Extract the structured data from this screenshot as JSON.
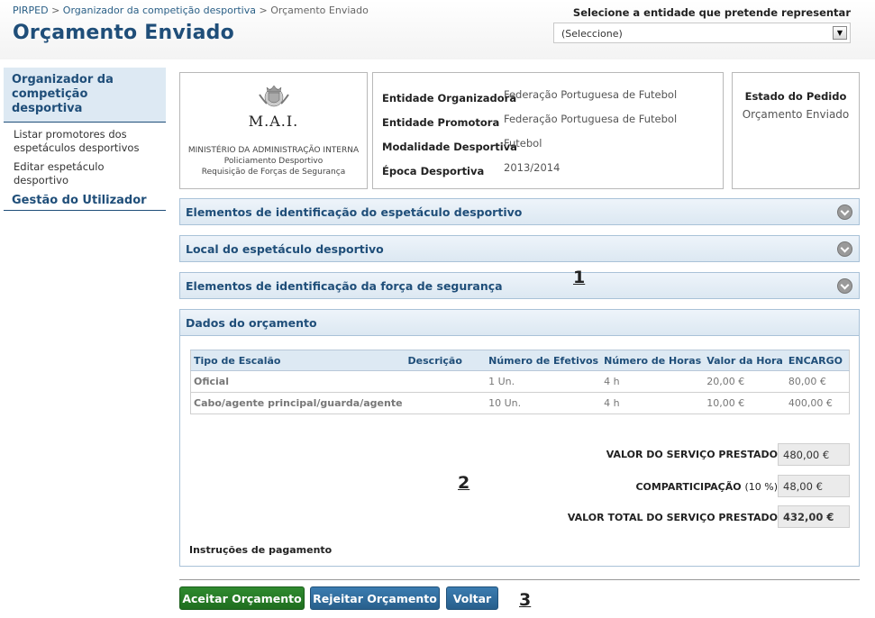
{
  "breadcrumb": [
    "PIRPED",
    "Organizador da competição desportiva",
    "Orçamento Enviado"
  ],
  "breadcrumb_sep": ">",
  "page_title": "Orçamento Enviado",
  "entity_selector": {
    "label": "Selecione a entidade que pretende representar",
    "value": "(Seleccione)"
  },
  "sidebar": {
    "active": "Organizador da competição desportiva",
    "items": [
      "Listar promotores dos espetáculos desportivos",
      "Editar espetáculo desportivo"
    ],
    "section": "Gestão do Utilizador"
  },
  "logo": {
    "acronym": "M.A.I.",
    "line1": "MINISTÉRIO DA ADMINISTRAÇÃO INTERNA",
    "line2": "Policiamento Desportivo",
    "line3": "Requisição de Forças de Segurança"
  },
  "info": [
    {
      "label": "Entidade Organizadora",
      "value": "Federação Portuguesa de Futebol"
    },
    {
      "label": "Entidade Promotora",
      "value": "Federação Portuguesa de Futebol"
    },
    {
      "label": "Modalidade Desportiva",
      "value": "Futebol"
    },
    {
      "label": "Época Desportiva",
      "value": "2013/2014"
    }
  ],
  "status": {
    "label": "Estado do Pedido",
    "value": "Orçamento Enviado"
  },
  "accordions": [
    "Elementos de identificação do espetáculo desportivo",
    "Local do espetáculo desportivo",
    "Elementos de identificação da força de segurança"
  ],
  "budget": {
    "title": "Dados do orçamento",
    "columns": [
      "Tipo de Escalão",
      "Descrição",
      "Número de Efetivos",
      "Número de Horas",
      "Valor da Hora",
      "ENCARGO"
    ],
    "rows": [
      [
        "Oficial",
        "",
        "1 Un.",
        "4 h",
        "20,00 €",
        "80,00 €"
      ],
      [
        "Cabo/agente principal/guarda/agente",
        "",
        "10 Un.",
        "4 h",
        "10,00 €",
        "400,00 €"
      ]
    ],
    "service_label": "VALOR DO SERVIÇO PRESTADO",
    "service_value": "480,00 €",
    "copay_label": "COMPARTICIPAÇÃO",
    "copay_pct": "(10 %)",
    "copay_value": "48,00 €",
    "total_label": "VALOR TOTAL DO SERVIÇO PRESTADO",
    "total_value": "432,00 €",
    "payment_instructions": "Instruções de pagamento"
  },
  "annotations": [
    "1",
    "2",
    "3"
  ],
  "buttons": {
    "accept": "Aceitar Orçamento",
    "reject": "Rejeitar Orçamento",
    "back": "Voltar"
  }
}
